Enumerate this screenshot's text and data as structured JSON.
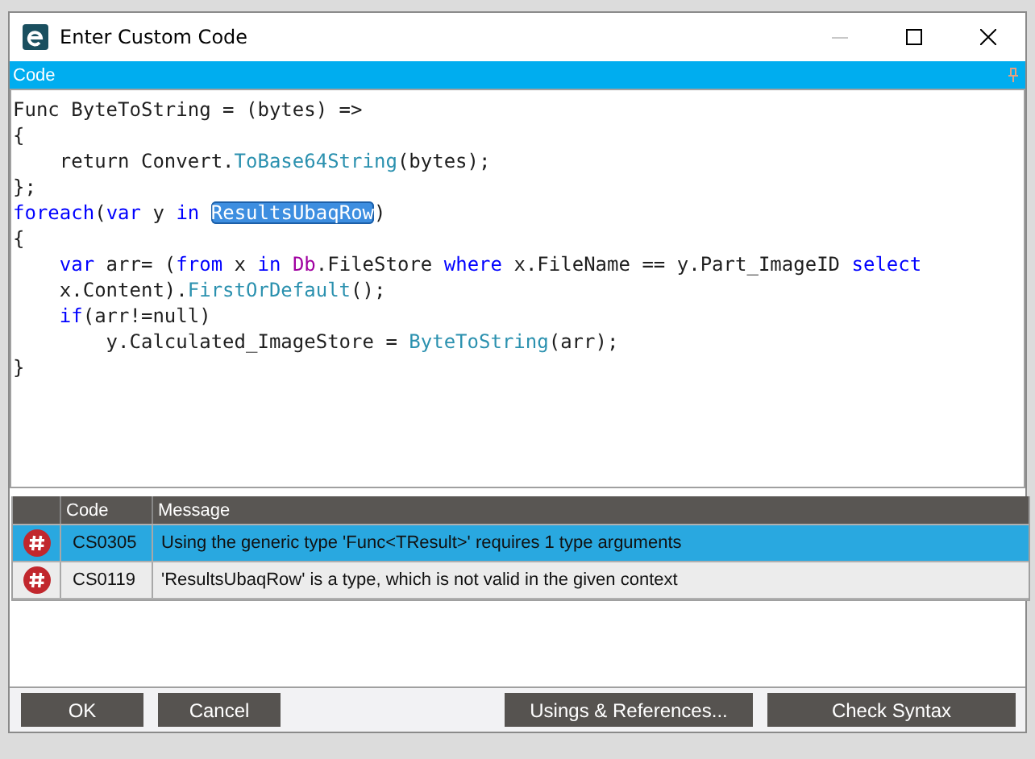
{
  "window": {
    "title": "Enter Custom Code",
    "minimize_disabled": true
  },
  "panel": {
    "title": "Code"
  },
  "code_lines": [
    [
      {
        "text": "Func ByteToString = (bytes) =>",
        "kind": "plain"
      }
    ],
    [
      {
        "text": "{",
        "kind": "plain"
      }
    ],
    [
      {
        "text": "    return Convert.",
        "kind": "plain"
      },
      {
        "text": "ToBase64String",
        "kind": "method"
      },
      {
        "text": "(bytes);",
        "kind": "plain"
      }
    ],
    [
      {
        "text": "};",
        "kind": "plain"
      }
    ],
    [
      {
        "text": "foreach",
        "kind": "keyword"
      },
      {
        "text": "(",
        "kind": "plain"
      },
      {
        "text": "var",
        "kind": "keyword"
      },
      {
        "text": " y ",
        "kind": "plain"
      },
      {
        "text": "in ",
        "kind": "keyword"
      },
      {
        "text": "ResultsUbaqRow",
        "kind": "selected"
      },
      {
        "text": ")",
        "kind": "plain"
      }
    ],
    [
      {
        "text": "{",
        "kind": "plain"
      }
    ],
    [
      {
        "text": "    var",
        "kind": "keyword"
      },
      {
        "text": " arr= (",
        "kind": "plain"
      },
      {
        "text": "from",
        "kind": "keyword"
      },
      {
        "text": " x ",
        "kind": "plain"
      },
      {
        "text": "in ",
        "kind": "keyword"
      },
      {
        "text": "Db",
        "kind": "type"
      },
      {
        "text": ".FileStore ",
        "kind": "plain"
      },
      {
        "text": "where",
        "kind": "keyword"
      },
      {
        "text": " x.FileName == y.Part_ImageID ",
        "kind": "plain"
      },
      {
        "text": "select",
        "kind": "keyword"
      }
    ],
    [
      {
        "text": "    x.Content).",
        "kind": "plain"
      },
      {
        "text": "FirstOrDefault",
        "kind": "method"
      },
      {
        "text": "();",
        "kind": "plain"
      }
    ],
    [
      {
        "text": "    if",
        "kind": "keyword"
      },
      {
        "text": "(arr!=null)",
        "kind": "plain"
      }
    ],
    [
      {
        "text": "        y.Calculated_ImageStore = ",
        "kind": "plain"
      },
      {
        "text": "ByteToString",
        "kind": "method"
      },
      {
        "text": "(arr);",
        "kind": "plain"
      }
    ],
    [
      {
        "text": "}",
        "kind": "plain"
      }
    ]
  ],
  "errors": {
    "columns": [
      "Code",
      "Message"
    ],
    "rows": [
      {
        "code": "CS0305",
        "message": "Using the generic type 'Func<TResult>' requires 1 type arguments",
        "selected": true
      },
      {
        "code": "CS0119",
        "message": "'ResultsUbaqRow' is a type, which is not valid in the given context",
        "selected": false
      }
    ]
  },
  "buttons_left": [
    "OK",
    "Cancel"
  ],
  "buttons_right": [
    "Usings & References...",
    "Check Syntax"
  ]
}
